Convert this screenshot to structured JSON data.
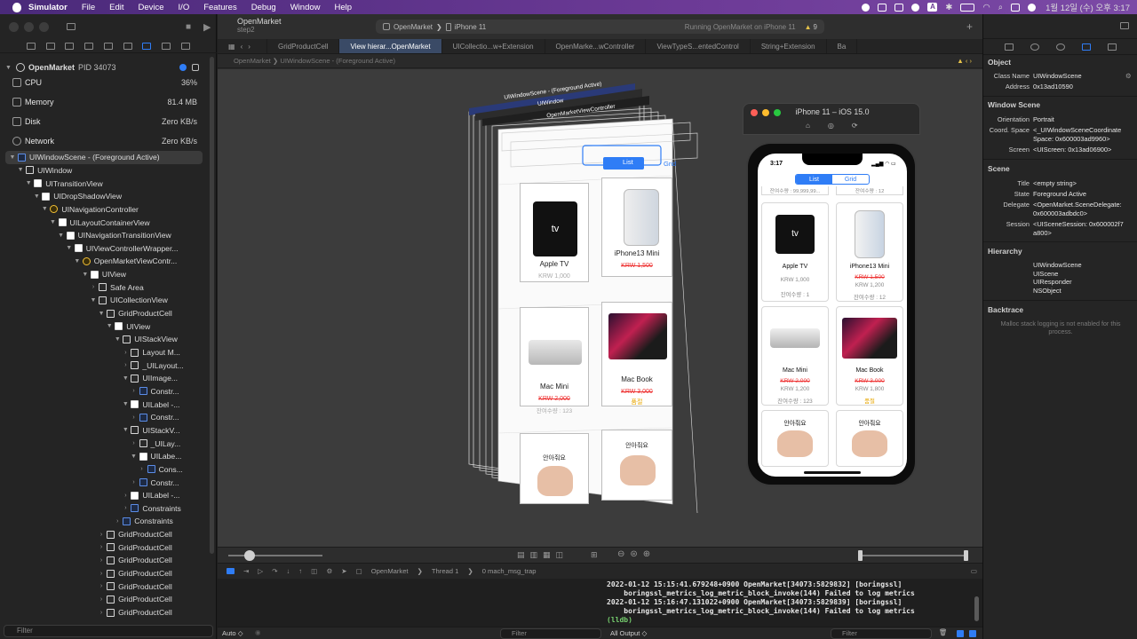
{
  "menubar": {
    "app": "Simulator",
    "items": [
      "File",
      "Edit",
      "Device",
      "I/O",
      "Features",
      "Debug",
      "Window",
      "Help"
    ],
    "clock": "1월 12일 (수) 오후 3:17",
    "a_label": "A"
  },
  "navigator": {
    "process": {
      "name": "OpenMarket",
      "pid": "PID 34073"
    },
    "gauges": [
      {
        "label": "CPU",
        "value": "36%"
      },
      {
        "label": "Memory",
        "value": "81.4 MB"
      },
      {
        "label": "Disk",
        "value": "Zero KB/s"
      },
      {
        "label": "Network",
        "value": "Zero KB/s"
      }
    ],
    "tree": [
      {
        "label": "UIWindowScene - (Foreground Active)",
        "indent": 0,
        "kind": "blue",
        "chev": "▼",
        "selected": true
      },
      {
        "label": "UIWindow",
        "indent": 1,
        "kind": "dark",
        "chev": "▼"
      },
      {
        "label": "UITransitionView",
        "indent": 2,
        "kind": "box",
        "chev": "▼"
      },
      {
        "label": "UIDropShadowView",
        "indent": 3,
        "kind": "box",
        "chev": "▼"
      },
      {
        "label": "UINavigationController",
        "indent": 4,
        "kind": "ctrl",
        "chev": "▼"
      },
      {
        "label": "UILayoutContainerView",
        "indent": 5,
        "kind": "box",
        "chev": "▼"
      },
      {
        "label": "UINavigationTransitionView",
        "indent": 6,
        "kind": "box",
        "chev": "▼"
      },
      {
        "label": "UIViewControllerWrapper...",
        "indent": 7,
        "kind": "box",
        "chev": "▼"
      },
      {
        "label": "OpenMarketViewContr...",
        "indent": 8,
        "kind": "ctrl",
        "chev": "▼"
      },
      {
        "label": "UIView",
        "indent": 9,
        "kind": "box",
        "chev": "▼"
      },
      {
        "label": "Safe Area",
        "indent": 10,
        "kind": "dark",
        "chev": "›"
      },
      {
        "label": "UICollectionView",
        "indent": 10,
        "kind": "dark",
        "chev": "▼"
      },
      {
        "label": "GridProductCell",
        "indent": 11,
        "kind": "dark",
        "chev": "▼"
      },
      {
        "label": "UIView",
        "indent": 12,
        "kind": "box",
        "chev": "▼"
      },
      {
        "label": "UIStackView",
        "indent": 13,
        "kind": "dark",
        "chev": "▼"
      },
      {
        "label": "Layout M...",
        "indent": 14,
        "kind": "dark",
        "chev": "›"
      },
      {
        "label": "_UILayout...",
        "indent": 14,
        "kind": "dark",
        "chev": "›"
      },
      {
        "label": "UIImage...",
        "indent": 14,
        "kind": "dark",
        "chev": "▼"
      },
      {
        "label": "Constr...",
        "indent": 15,
        "kind": "blue",
        "chev": "›"
      },
      {
        "label": "UILabel -...",
        "indent": 14,
        "kind": "box",
        "chev": "▼"
      },
      {
        "label": "Constr...",
        "indent": 15,
        "kind": "blue",
        "chev": "›"
      },
      {
        "label": "UIStackV...",
        "indent": 14,
        "kind": "dark",
        "chev": "▼"
      },
      {
        "label": "_UILay...",
        "indent": 15,
        "kind": "dark",
        "chev": "›"
      },
      {
        "label": "UILabe...",
        "indent": 15,
        "kind": "box",
        "chev": "▼"
      },
      {
        "label": "Cons...",
        "indent": 16,
        "kind": "blue",
        "chev": "›"
      },
      {
        "label": "Constr...",
        "indent": 15,
        "kind": "blue",
        "chev": "›"
      },
      {
        "label": "UILabel -...",
        "indent": 14,
        "kind": "box",
        "chev": "›"
      },
      {
        "label": "Constraints",
        "indent": 14,
        "kind": "blue",
        "chev": "›"
      },
      {
        "label": "Constraints",
        "indent": 13,
        "kind": "blue",
        "chev": "›"
      },
      {
        "label": "GridProductCell",
        "indent": 11,
        "kind": "dark",
        "chev": "›"
      },
      {
        "label": "GridProductCell",
        "indent": 11,
        "kind": "dark",
        "chev": "›"
      },
      {
        "label": "GridProductCell",
        "indent": 11,
        "kind": "dark",
        "chev": "›"
      },
      {
        "label": "GridProductCell",
        "indent": 11,
        "kind": "dark",
        "chev": "›"
      },
      {
        "label": "GridProductCell",
        "indent": 11,
        "kind": "dark",
        "chev": "›"
      },
      {
        "label": "GridProductCell",
        "indent": 11,
        "kind": "dark",
        "chev": "›"
      },
      {
        "label": "GridProductCell",
        "indent": 11,
        "kind": "dark",
        "chev": "›"
      }
    ],
    "filter_placeholder": "Filter"
  },
  "editor": {
    "project": {
      "name": "OpenMarket",
      "branch": "step2"
    },
    "scheme": {
      "target": "OpenMarket",
      "device": "iPhone 11",
      "status": "Running OpenMarket on iPhone 11",
      "warnings": "9"
    },
    "tabs": [
      "GridProductCell",
      "View hierar...OpenMarket",
      "UICollectio...w+Extension",
      "OpenMarke...wController",
      "ViewTypeS...entedControl",
      "String+Extension",
      "Ba"
    ],
    "active_tab": 1,
    "jumpbar": [
      "OpenMarket",
      "UIWindowScene - (Foreground Active)"
    ],
    "debug": {
      "process": "OpenMarket",
      "thread": "Thread 1",
      "frame": "0 mach_msg_trap"
    },
    "console_lines": [
      "2022-01-12 15:15:41.679248+0900 OpenMarket[34073:5829832] [boringssl]",
      "    boringssl_metrics_log_metric_block_invoke(144) Failed to log metrics",
      "2022-01-12 15:16:47.131022+0900 OpenMarket[34073:5829839] [boringssl]",
      "    boringssl_metrics_log_metric_block_invoke(144) Failed to log metrics"
    ],
    "lldb": "(lldb)",
    "auto_label": "Auto ◇",
    "all_output": "All Output ◇",
    "filter_placeholder": "Filter"
  },
  "scene3d": {
    "headers": [
      "UIWindowScene - (Foreground Active)",
      "UIWindow",
      "OpenMarketViewController"
    ],
    "segment": [
      "List",
      "Grid"
    ],
    "cards": [
      {
        "name": "Apple TV",
        "price": "KRW 1,000",
        "stock": "잔여수량 : 1"
      },
      {
        "name": "iPhone13 Mini",
        "price": "KRW 1,500",
        "stock": ""
      },
      {
        "name": "Mac Mini",
        "price": "KRW 2,000",
        "stock": "잔여수량 : 123"
      },
      {
        "name": "Mac Book",
        "price": "KRW 3,000",
        "stock": "품절"
      },
      {
        "name": "안아줘요",
        "price": "",
        "stock": ""
      },
      {
        "name": "안아줘요",
        "price": "",
        "stock": ""
      }
    ]
  },
  "simulator": {
    "title": "iPhone 11 – iOS 15.0",
    "time": "3:17",
    "segment": [
      "List",
      "Grid"
    ],
    "top_stock_left": "잔여수량 : 99,999,99...",
    "top_stock_right": "잔여수량 : 12",
    "products": [
      {
        "name": "Apple TV",
        "price": "KRW 1,000",
        "bargain": "",
        "stock": "잔여수량 : 1",
        "soldout": false
      },
      {
        "name": "iPhone13 Mini",
        "price": "KRW 1,500",
        "bargain": "KRW 1,200",
        "stock": "잔여수량 : 12",
        "soldout": false
      },
      {
        "name": "Mac Mini",
        "price": "KRW 2,000",
        "bargain": "KRW 1,200",
        "stock": "잔여수량 : 123",
        "soldout": false
      },
      {
        "name": "Mac Book",
        "price": "KRW 3,000",
        "bargain": "KRW 1,800",
        "stock": "품절",
        "soldout": true
      },
      {
        "name": "안아줘요",
        "price": "",
        "bargain": "",
        "stock": "",
        "soldout": false
      },
      {
        "name": "안아줘요",
        "price": "",
        "bargain": "",
        "stock": "",
        "soldout": false
      }
    ]
  },
  "inspector": {
    "object": {
      "title": "Object",
      "class_name_label": "Class Name",
      "class_name": "UIWindowScene",
      "address_label": "Address",
      "address": "0x13ad10590"
    },
    "window_scene": {
      "title": "Window Scene",
      "orientation_label": "Orientation",
      "orientation": "Portrait",
      "coord_label": "Coord. Space",
      "coord": "<_UIWindowSceneCoordinateSpace: 0x600003ad9960>",
      "screen_label": "Screen",
      "screen": "<UIScreen: 0x13ad06900>"
    },
    "scene": {
      "title": "Scene",
      "title_label": "Title",
      "title_value": "<empty string>",
      "state_label": "State",
      "state": "Foreground Active",
      "delegate_label": "Delegate",
      "delegate": "<OpenMarket.SceneDelegate: 0x600003adbdc0>",
      "session_label": "Session",
      "session": "<UISceneSession: 0x600002f7a800>"
    },
    "hierarchy": {
      "title": "Hierarchy",
      "items": [
        "UIWindowScene",
        "UIScene",
        "UIResponder",
        "NSObject"
      ]
    },
    "backtrace": {
      "title": "Backtrace",
      "message": "Malloc stack logging is not enabled for this process."
    }
  },
  "colors": {
    "accent": "#2f7df6",
    "selection": "#3a4a66",
    "menubar": "#6c3a96",
    "price_red": "#e33333",
    "soldout": "#e7a600"
  }
}
